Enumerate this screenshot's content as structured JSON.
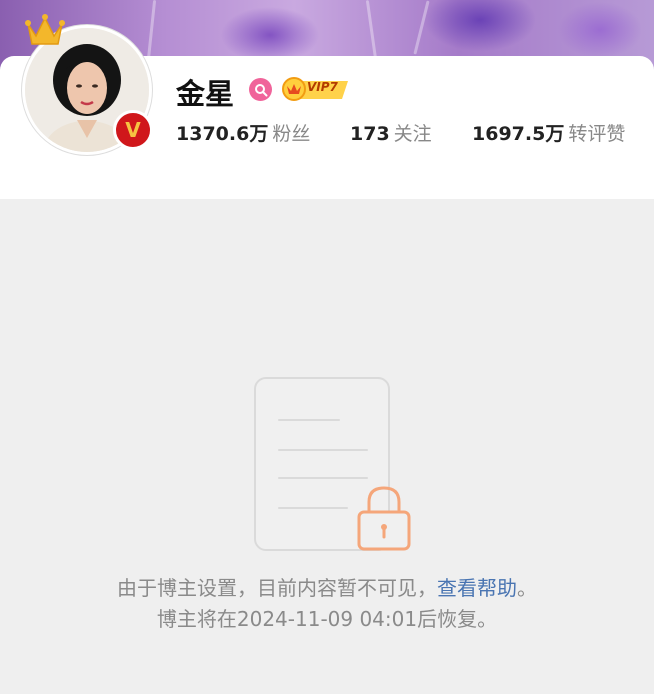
{
  "profile": {
    "name": "金星",
    "vip_level": "VIP7",
    "verified_badge_letter": "V"
  },
  "stats": [
    {
      "value": "1370.6万",
      "label": "粉丝"
    },
    {
      "value": "173",
      "label": "关注"
    },
    {
      "value": "1697.5万",
      "label": "转评赞"
    }
  ],
  "notice": {
    "line1_text": "由于博主设置，目前内容暂不可见，",
    "help_link": "查看帮助",
    "line1_end": "。",
    "line2": "博主将在2024-11-09 04:01后恢复。"
  },
  "colors": {
    "verified_red": "#d0171b",
    "link_blue": "#4a75b2",
    "lock_orange": "#f5a67a",
    "search_badge_pink": "#f0649a"
  },
  "icons": [
    "crown-icon",
    "verified-v-icon",
    "search-badge-icon",
    "vip-crown-icon",
    "document-icon",
    "lock-icon"
  ]
}
